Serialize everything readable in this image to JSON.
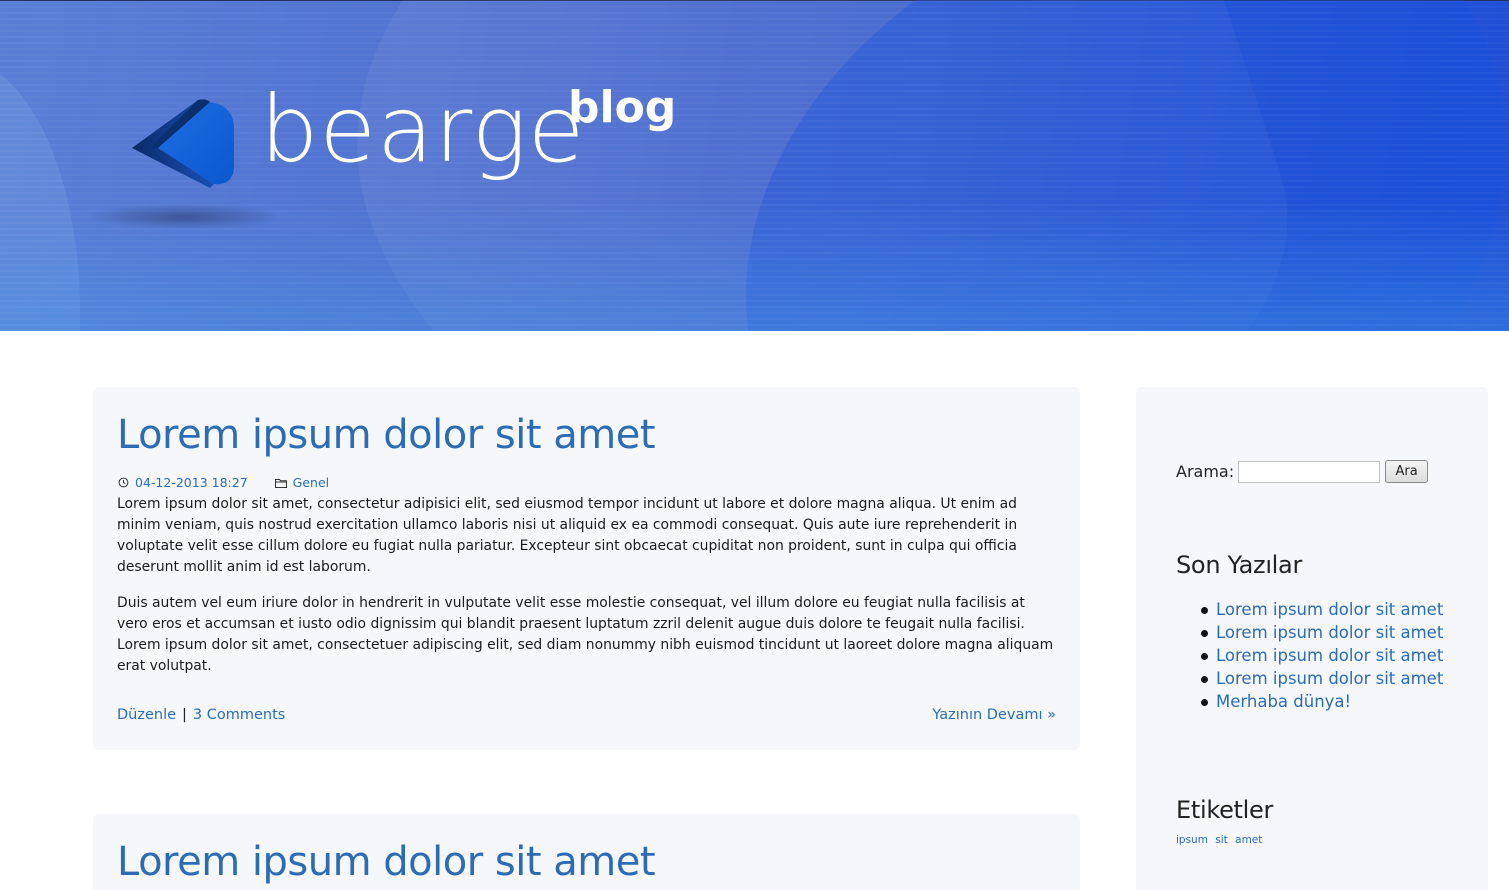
{
  "header": {
    "logo_word": "bearge",
    "logo_sup": "blog"
  },
  "posts": [
    {
      "title": "Lorem ipsum dolor sit amet",
      "date": "04-12-2013 18:27",
      "category": "Genel",
      "paragraphs": [
        "Lorem ipsum dolor sit amet, consectetur adipisici elit, sed eiusmod tempor incidunt ut labore et dolore magna aliqua. Ut enim ad minim veniam, quis nostrud exercitation ullamco laboris nisi ut aliquid ex ea commodi consequat. Quis aute iure reprehenderit in voluptate velit esse cillum dolore eu fugiat nulla pariatur. Excepteur sint obcaecat cupiditat non proident, sunt in culpa qui officia deserunt mollit anim id est laborum.",
        "Duis autem vel eum iriure dolor in hendrerit in vulputate velit esse molestie consequat, vel illum dolore eu feugiat nulla facilisis at vero eros et accumsan et iusto odio dignissim qui blandit praesent luptatum zzril delenit augue duis dolore te feugait nulla facilisi. Lorem ipsum dolor sit amet, consectetuer adipiscing elit, sed diam nonummy nibh euismod tincidunt ut laoreet dolore magna aliquam erat volutpat."
      ],
      "edit_label": "Düzenle",
      "separator": "|",
      "comments_label": "3 Comments",
      "read_more_label": "Yazının Devamı »"
    },
    {
      "title": "Lorem ipsum dolor sit amet"
    }
  ],
  "sidebar": {
    "search_label": "Arama:",
    "search_value": "",
    "search_button": "Ara",
    "recent_title": "Son Yazılar",
    "recent_posts": [
      "Lorem ipsum dolor sit amet",
      "Lorem ipsum dolor sit amet",
      "Lorem ipsum dolor sit amet",
      "Lorem ipsum dolor sit amet",
      "Merhaba dünya!"
    ],
    "tags_title": "Etiketler",
    "tags": [
      "ipsum",
      "sit",
      "amet"
    ]
  },
  "icons": {
    "date_icon": "clock-icon",
    "category_icon": "folder-icon"
  },
  "colors": {
    "link": "#2b6cb5",
    "card_bg": "#f6f7fa",
    "header_start": "#5b7fd6",
    "header_end": "#1e4fd8"
  }
}
